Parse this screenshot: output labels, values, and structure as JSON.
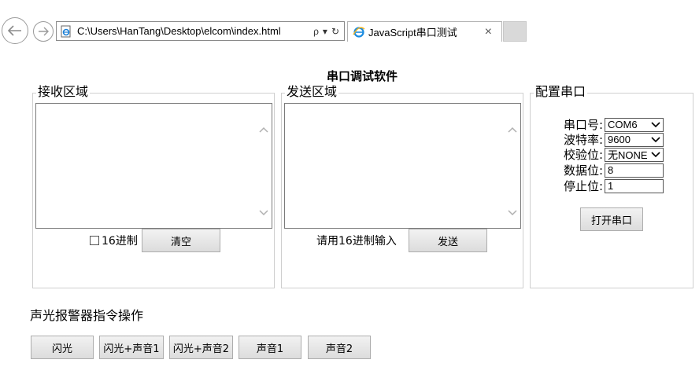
{
  "browser": {
    "address": "C:\\Users\\HanTang\\Desktop\\elcom\\index.html",
    "search_glyph": "ρ",
    "dropdown_glyph": "▾",
    "refresh_glyph": "↻",
    "tab_title": "JavaScript串口测试",
    "tab_close": "×"
  },
  "page": {
    "title": "串口调试软件"
  },
  "receive": {
    "legend": "接收区域",
    "hex_label": "16进制",
    "clear_button": "清空"
  },
  "send": {
    "legend": "发送区域",
    "hint": "请用16进制输入",
    "send_button": "发送"
  },
  "config": {
    "legend": "配置串口",
    "port_label": "串口号:",
    "port_value": "COM6",
    "baud_label": "波特率:",
    "baud_value": "9600",
    "parity_label": "校验位:",
    "parity_value": "无NONE",
    "databits_label": "数据位:",
    "databits_value": "8",
    "stopbits_label": "停止位:",
    "stopbits_value": "1",
    "open_button": "打开串口"
  },
  "alarm": {
    "title": "声光报警器指令操作",
    "buttons": [
      "闪光",
      "闪光+声音1",
      "闪光+声音2",
      "声音1",
      "声音2"
    ]
  }
}
